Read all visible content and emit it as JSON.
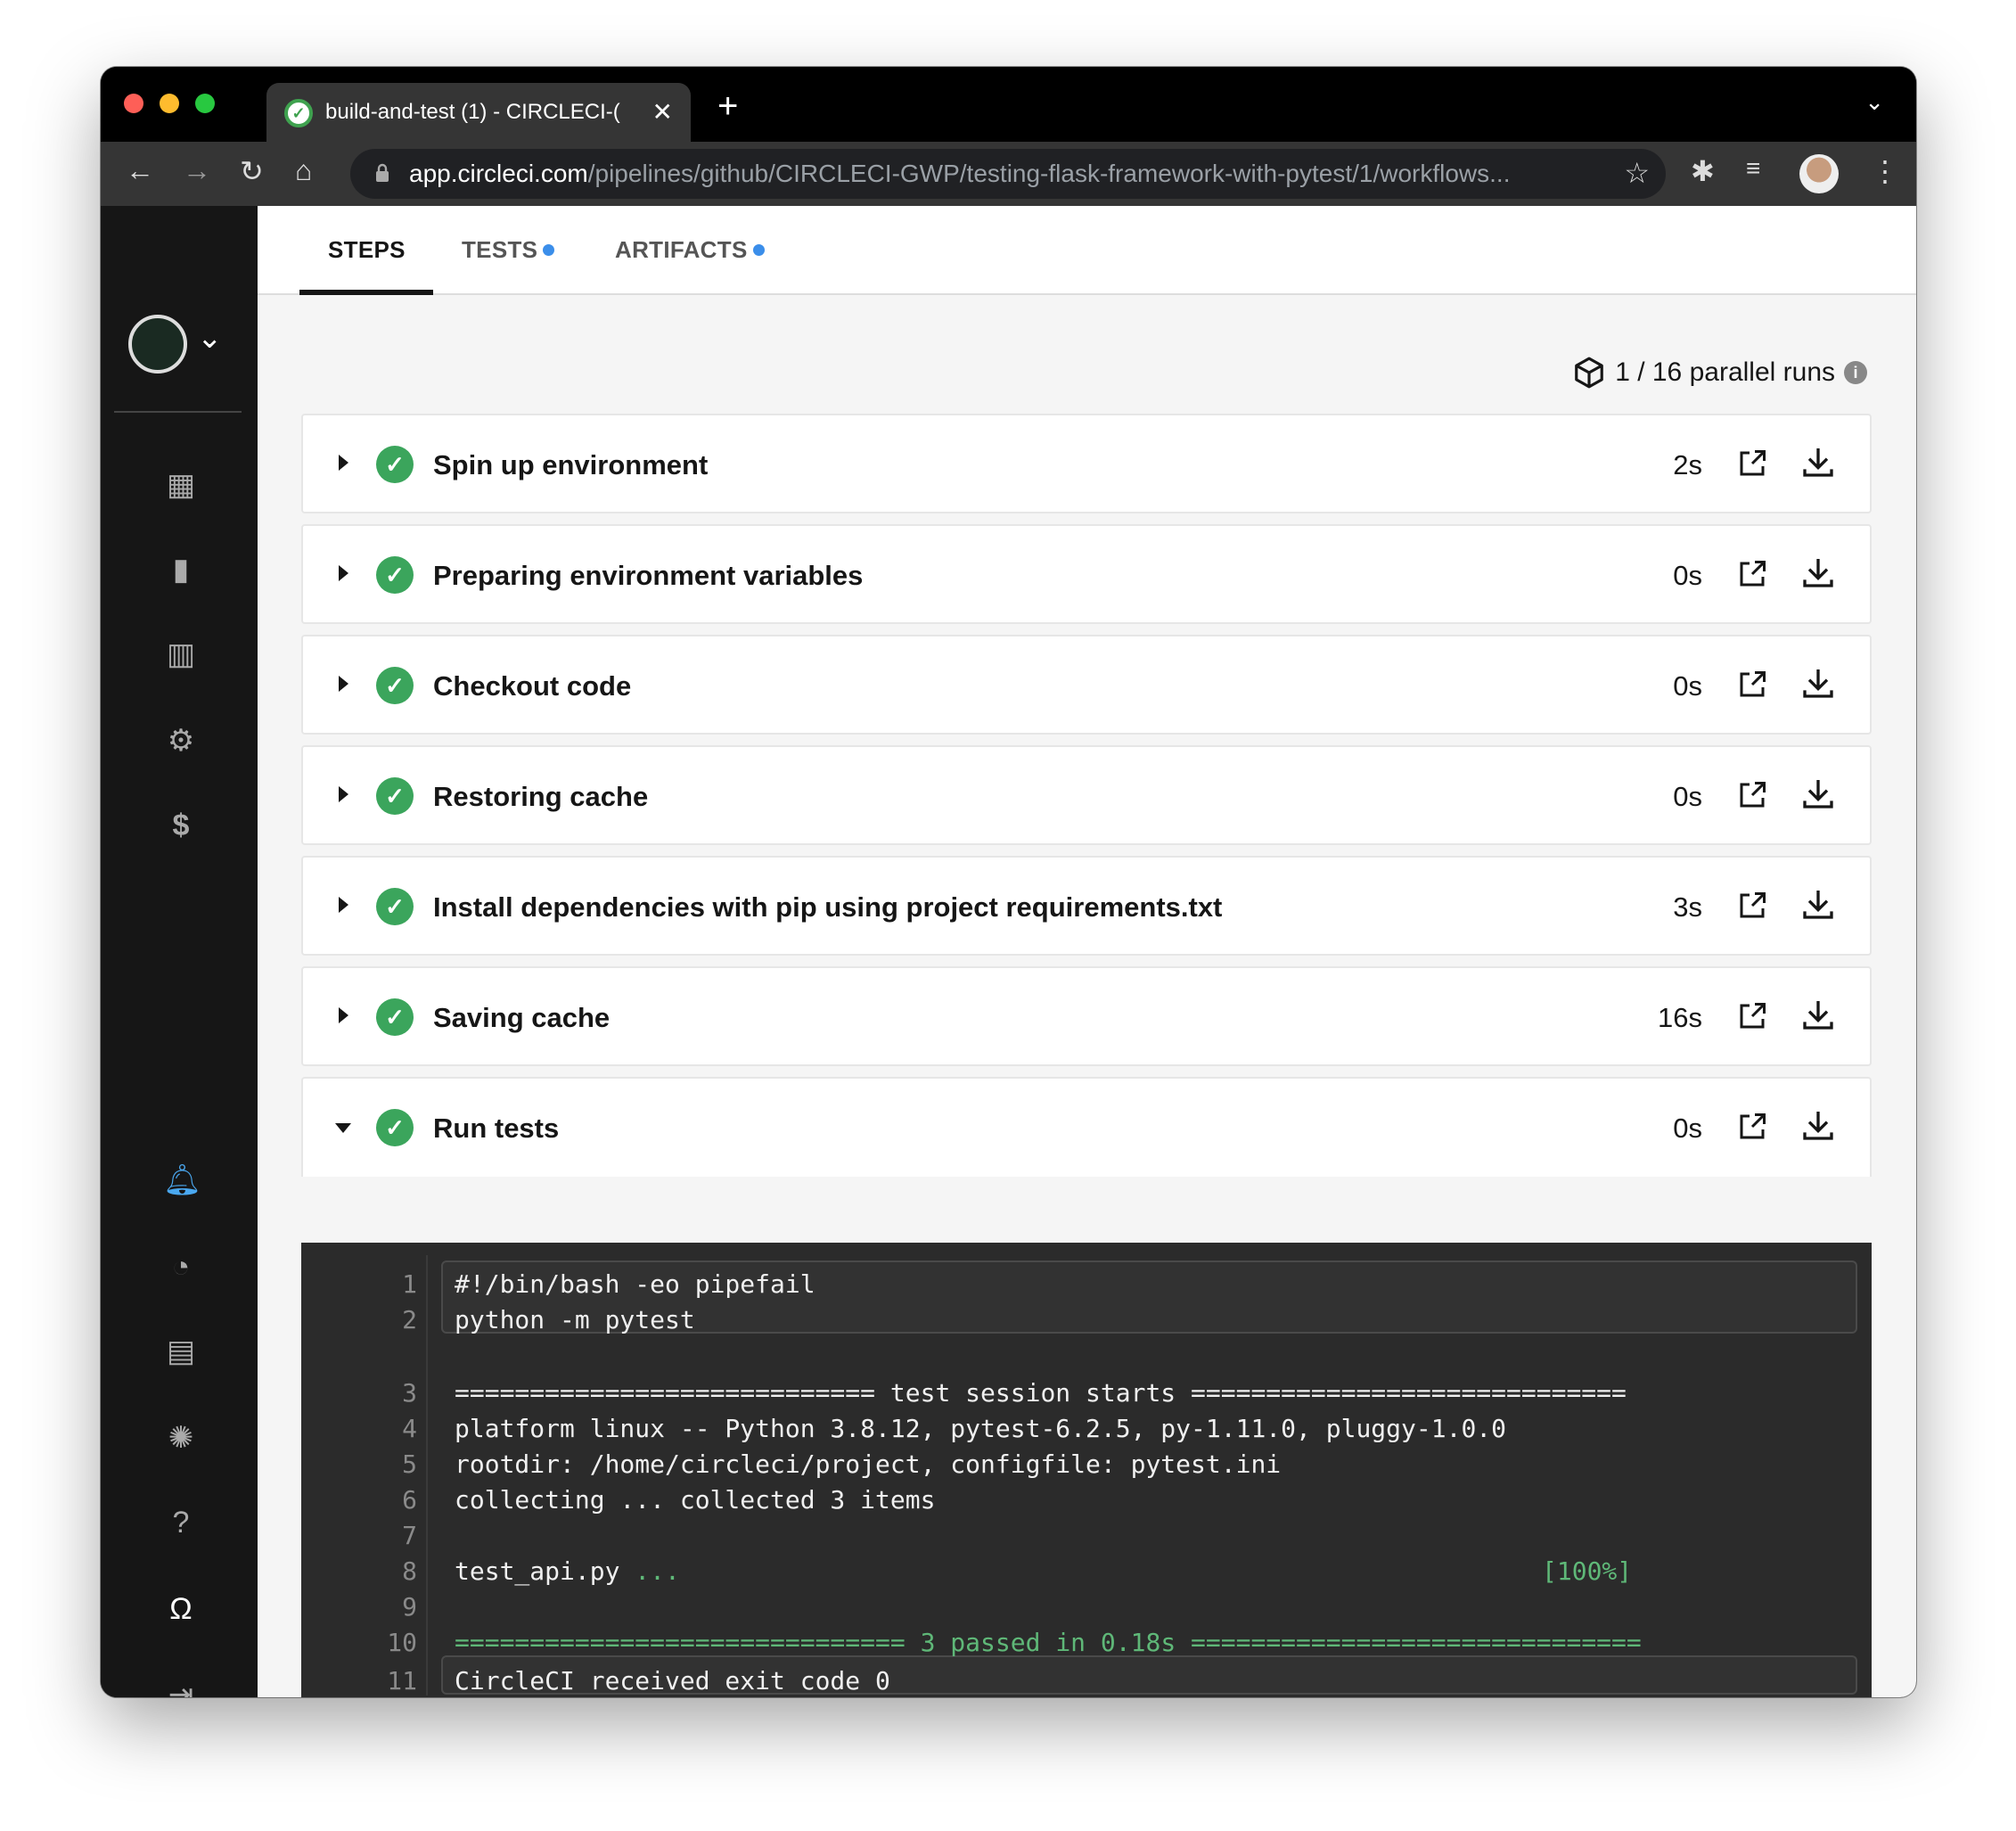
{
  "browser": {
    "tab_title": "build-and-test (1) - CIRCLECI-(",
    "url_host": "app.circleci.com",
    "url_path": "/pipelines/github/CIRCLECI-GWP/testing-flask-framework-with-pytest/1/workflows..."
  },
  "tabs": [
    {
      "label": "STEPS"
    },
    {
      "label": "TESTS"
    },
    {
      "label": "ARTIFACTS"
    }
  ],
  "parallel_runs": "1 / 16 parallel runs",
  "steps": [
    {
      "title": "Spin up environment",
      "duration": "2s"
    },
    {
      "title": "Preparing environment variables",
      "duration": "0s"
    },
    {
      "title": "Checkout code",
      "duration": "0s"
    },
    {
      "title": "Restoring cache",
      "duration": "0s"
    },
    {
      "title": "Install dependencies with pip using project requirements.txt",
      "duration": "3s"
    },
    {
      "title": "Saving cache",
      "duration": "16s"
    },
    {
      "title": "Run tests",
      "duration": "0s"
    }
  ],
  "terminal": {
    "lines": [
      {
        "n": "1",
        "text": "#!/bin/bash -eo pipefail"
      },
      {
        "n": "2",
        "text": "python -m pytest"
      },
      {
        "n": "3",
        "text": "============================ test session starts ============================="
      },
      {
        "n": "4",
        "text": "platform linux -- Python 3.8.12, pytest-6.2.5, py-1.11.0, pluggy-1.0.0"
      },
      {
        "n": "5",
        "text": "rootdir: /home/circleci/project, configfile: pytest.ini"
      },
      {
        "n": "6",
        "text": "collecting ... collected 3 items"
      },
      {
        "n": "7",
        "text": ""
      },
      {
        "n": "8",
        "text": "test_api.py ",
        "dots": "...",
        "pct": "[100%]"
      },
      {
        "n": "9",
        "text": ""
      },
      {
        "n": "10",
        "eq1": "==============================",
        "passed": "3 passed",
        "in": "in 0.18s",
        "eq2": "=============================="
      },
      {
        "n": "11",
        "text": "CircleCI received exit code 0"
      }
    ]
  },
  "colors": {
    "success": "#3ba55c",
    "accent": "#3b8eea",
    "terminal_bg": "#2b2b2b"
  }
}
